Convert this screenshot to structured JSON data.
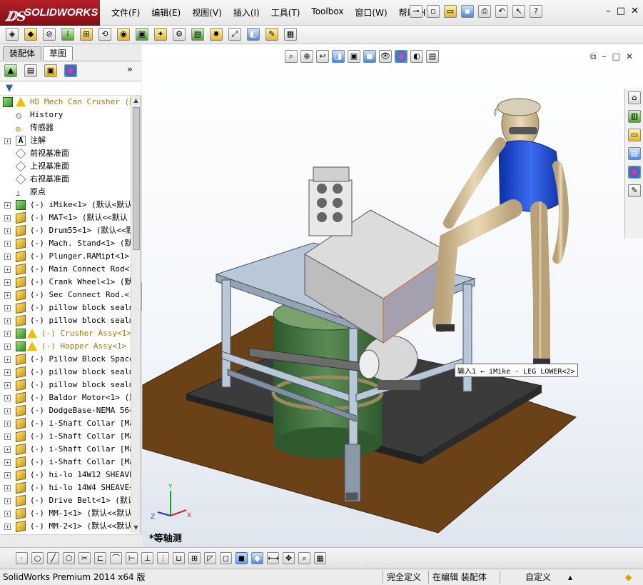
{
  "app": {
    "brand": "SOLIDWORKS",
    "menu": [
      "文件(F)",
      "编辑(E)",
      "视图(V)",
      "插入(I)",
      "工具(T)",
      "Toolbox",
      "窗口(W)",
      "帮助(H)"
    ]
  },
  "left_panel": {
    "tabs": [
      "装配体",
      "草图"
    ],
    "expand_label": "»",
    "tree": [
      {
        "label": "HD Mech Can Crusher  (默",
        "kind": "top",
        "warn": true
      },
      {
        "label": "History",
        "kind": "history",
        "exp": false
      },
      {
        "label": "传感器",
        "kind": "sensor",
        "exp": false
      },
      {
        "label": "注解",
        "kind": "annot",
        "exp": true
      },
      {
        "label": "前视基准面",
        "kind": "plane",
        "exp": false
      },
      {
        "label": "上视基准面",
        "kind": "plane",
        "exp": false
      },
      {
        "label": "右视基准面",
        "kind": "plane",
        "exp": false
      },
      {
        "label": "原点",
        "kind": "origin",
        "exp": false
      },
      {
        "label": "(-) iMike<1> (默认<默认",
        "kind": "asm",
        "exp": true
      },
      {
        "label": "(-) MAT<1> (默认<<默认",
        "kind": "part",
        "exp": true
      },
      {
        "label": "(-) Drum55<1> (默认<<默",
        "kind": "part",
        "exp": true
      },
      {
        "label": "(-) Mach. Stand<1> (默认",
        "kind": "part",
        "exp": true
      },
      {
        "label": "(-) Plunger.RAMipt<1> (",
        "kind": "part",
        "exp": true
      },
      {
        "label": "(-) Main Connect Rod<1>",
        "kind": "part",
        "exp": true
      },
      {
        "label": "(-) Crank Wheel<1> (默认",
        "kind": "part",
        "exp": true
      },
      {
        "label": "(-) Sec Connect Rod.<1>",
        "kind": "part",
        "exp": true
      },
      {
        "label": "(-) pillow block sealma",
        "kind": "part",
        "exp": true
      },
      {
        "label": "(-) pillow block sealma",
        "kind": "part",
        "exp": true
      },
      {
        "label": "(-) Crusher Assy<1>",
        "kind": "asm",
        "exp": true,
        "warn": true,
        "yellow": true
      },
      {
        "label": "(-) Hopper Assy<1> (",
        "kind": "asm",
        "exp": true,
        "warn": true,
        "yellow": true
      },
      {
        "label": "(-) Pillow Block Spacer",
        "kind": "part",
        "exp": true
      },
      {
        "label": "(-) pillow block sealma",
        "kind": "part",
        "exp": true
      },
      {
        "label": "(-) pillow block sealma",
        "kind": "part",
        "exp": true
      },
      {
        "label": "(-) Baldor Motor<1> (默",
        "kind": "part",
        "exp": true
      },
      {
        "label": "(-) DodgeBase-NEMA 56<1",
        "kind": "part",
        "exp": true
      },
      {
        "label": "(-) i-Shaft Collar [Mat",
        "kind": "part",
        "exp": true
      },
      {
        "label": "(-) i-Shaft Collar [Mat",
        "kind": "part",
        "exp": true
      },
      {
        "label": "(-) i-Shaft Collar [Mat",
        "kind": "part",
        "exp": true
      },
      {
        "label": "(-) i-Shaft Collar [Mat",
        "kind": "part",
        "exp": true
      },
      {
        "label": "(-) hi-lo 14W12 SHEAVE<",
        "kind": "part",
        "exp": true
      },
      {
        "label": "(-) hi-lo 14W4 SHEAVE<1",
        "kind": "part",
        "exp": true
      },
      {
        "label": "(-) Drive Belt<1> (默认",
        "kind": "part",
        "exp": true
      },
      {
        "label": "(-) MM-1<1> (默认<<默认",
        "kind": "part",
        "exp": true
      },
      {
        "label": "(-) MM-2<1> (默认<<默认",
        "kind": "part",
        "exp": true
      }
    ]
  },
  "viewport": {
    "view_name": "*等轴测",
    "tooltip": "输入1 ← iMike - LEG LOWER<2>"
  },
  "status": {
    "product": "SolidWorks Premium 2014 x64 版",
    "state1": "完全定义",
    "state2": "在编辑 装配体",
    "units": "自定义"
  }
}
